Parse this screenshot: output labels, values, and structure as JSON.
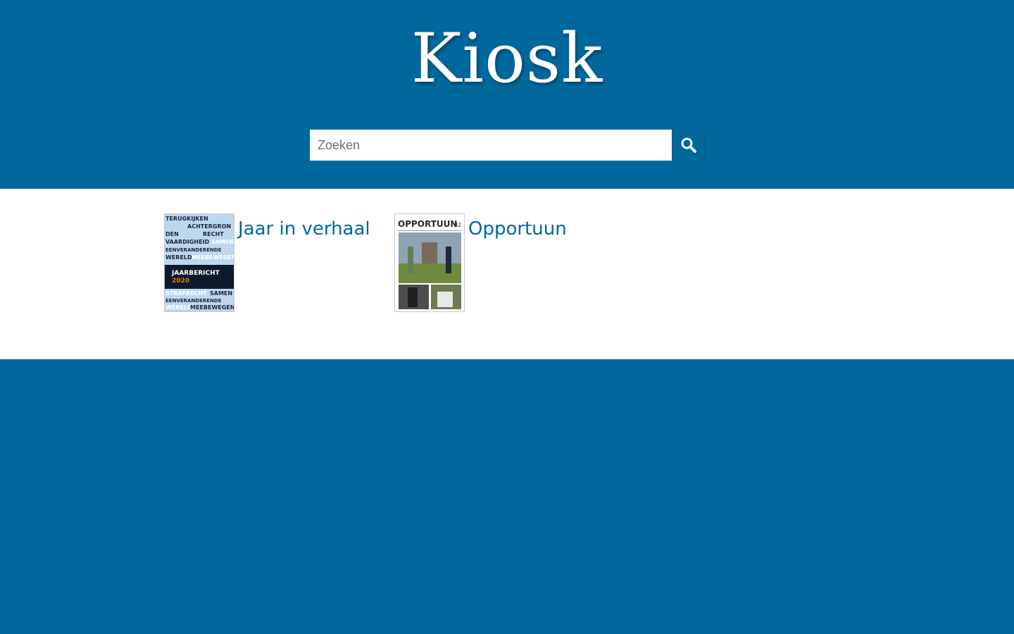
{
  "header": {
    "logo_text": "Kiosk"
  },
  "search": {
    "placeholder": "Zoeken",
    "value": "",
    "button_icon": "search-icon"
  },
  "publications": [
    {
      "title": "Jaar in verhaal",
      "cover": {
        "lines": [
          "TERUGKIJKEN",
          "ACHTERGRON",
          "DEN",
          "RECHT",
          "VAARDIGHEID",
          "SAMEN",
          "EENVERANDERENDE",
          "WERELD",
          "MEEBEWEGEN"
        ],
        "banner": "JAARBERICHT",
        "year": "2020",
        "bottom_lines": [
          "STRAFRECHT",
          "SAMEN",
          "EENVERANDERENDE",
          "WERELD",
          "MEEBEWEGEN"
        ]
      }
    },
    {
      "title": "Opportuun",
      "cover": {
        "masthead": "OPPORTUUN",
        "issue": "02"
      }
    }
  ],
  "colors": {
    "brand": "#00689d",
    "content_bg": "#ffffff",
    "link": "#00689d"
  }
}
